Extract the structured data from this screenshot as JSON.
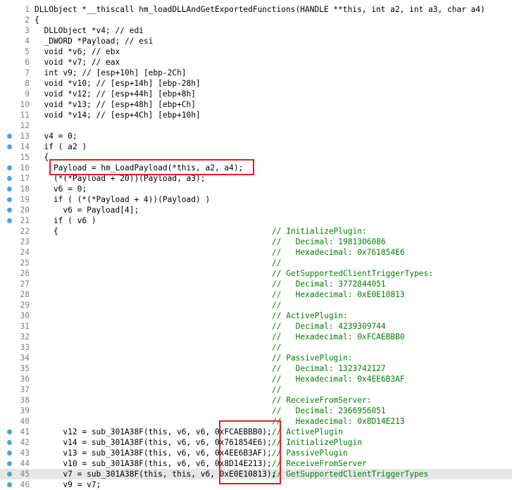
{
  "lines": [
    {
      "n": "1",
      "dot": false,
      "code": "DLLObject *__thiscall hm_loadDLLAndGetExportedFunctions(HANDLE **this, int a2, int a3, char a4)",
      "comment": ""
    },
    {
      "n": "2",
      "dot": false,
      "code": "{",
      "comment": ""
    },
    {
      "n": "3",
      "dot": false,
      "code": "  DLLObject *v4; // edi",
      "comment": ""
    },
    {
      "n": "4",
      "dot": false,
      "code": "  _DWORD *Payload; // esi",
      "comment": ""
    },
    {
      "n": "5",
      "dot": false,
      "code": "  void *v6; // ebx",
      "comment": ""
    },
    {
      "n": "6",
      "dot": false,
      "code": "  void *v7; // eax",
      "comment": ""
    },
    {
      "n": "7",
      "dot": false,
      "code": "  int v9; // [esp+10h] [ebp-2Ch]",
      "comment": ""
    },
    {
      "n": "8",
      "dot": false,
      "code": "  void *v10; // [esp+14h] [ebp-28h]",
      "comment": ""
    },
    {
      "n": "9",
      "dot": false,
      "code": "  void *v12; // [esp+44h] [ebp+8h]",
      "comment": ""
    },
    {
      "n": "10",
      "dot": false,
      "code": "  void *v13; // [esp+48h] [ebp+Ch]",
      "comment": ""
    },
    {
      "n": "11",
      "dot": false,
      "code": "  void *v14; // [esp+4Ch] [ebp+10h]",
      "comment": ""
    },
    {
      "n": "12",
      "dot": false,
      "code": "",
      "comment": ""
    },
    {
      "n": "13",
      "dot": true,
      "code": "  v4 = 0;",
      "comment": ""
    },
    {
      "n": "14",
      "dot": true,
      "code": "  if ( a2 )",
      "comment": ""
    },
    {
      "n": "15",
      "dot": false,
      "code": "  {",
      "comment": ""
    },
    {
      "n": "16",
      "dot": true,
      "code": "    Payload = hm_LoadPayload(*this, a2, a4);",
      "comment": ""
    },
    {
      "n": "17",
      "dot": true,
      "code": "    (*(*Payload + 20))(Payload, a3);",
      "comment": ""
    },
    {
      "n": "18",
      "dot": true,
      "code": "    v6 = 0;",
      "comment": ""
    },
    {
      "n": "19",
      "dot": true,
      "code": "    if ( (*(*Payload + 4))(Payload) )",
      "comment": ""
    },
    {
      "n": "20",
      "dot": true,
      "code": "      v6 = Payload[4];",
      "comment": ""
    },
    {
      "n": "21",
      "dot": true,
      "code": "    if ( v6 )",
      "comment": ""
    },
    {
      "n": "22",
      "dot": false,
      "code": "    {",
      "comment": "// InitializePlugin:"
    },
    {
      "n": "23",
      "dot": false,
      "code": "",
      "comment": "//   Decimal: 1981306086"
    },
    {
      "n": "24",
      "dot": false,
      "code": "",
      "comment": "//   Hexadecimal: 0x761854E6"
    },
    {
      "n": "25",
      "dot": false,
      "code": "",
      "comment": "//"
    },
    {
      "n": "26",
      "dot": false,
      "code": "",
      "comment": "// GetSupportedClientTriggerTypes:"
    },
    {
      "n": "27",
      "dot": false,
      "code": "",
      "comment": "//   Decimal: 3772844051"
    },
    {
      "n": "28",
      "dot": false,
      "code": "",
      "comment": "//   Hexadecimal: 0xE0E10813"
    },
    {
      "n": "29",
      "dot": false,
      "code": "",
      "comment": "//"
    },
    {
      "n": "30",
      "dot": false,
      "code": "",
      "comment": "// ActivePlugin:"
    },
    {
      "n": "31",
      "dot": false,
      "code": "",
      "comment": "//   Decimal: 4239309744"
    },
    {
      "n": "32",
      "dot": false,
      "code": "",
      "comment": "//   Hexadecimal: 0xFCAEBBB0"
    },
    {
      "n": "33",
      "dot": false,
      "code": "",
      "comment": "//"
    },
    {
      "n": "34",
      "dot": false,
      "code": "",
      "comment": "// PassivePlugin:"
    },
    {
      "n": "35",
      "dot": false,
      "code": "",
      "comment": "//   Decimal: 1323742127"
    },
    {
      "n": "36",
      "dot": false,
      "code": "",
      "comment": "//   Hexadecimal: 0x4EE6B3AF"
    },
    {
      "n": "37",
      "dot": false,
      "code": "",
      "comment": "//"
    },
    {
      "n": "38",
      "dot": false,
      "code": "",
      "comment": "// ReceiveFromServer:"
    },
    {
      "n": "39",
      "dot": false,
      "code": "",
      "comment": "//   Decimal: 2366956051"
    },
    {
      "n": "40",
      "dot": false,
      "code": "",
      "comment": "//   Hexadecimal: 0x8D14E213"
    },
    {
      "n": "41",
      "dot": true,
      "code": "      v12 = sub_301A38F(this, v6, v6, 0xFCAEBBB0);",
      "comment": "// ActivePlugin"
    },
    {
      "n": "42",
      "dot": true,
      "code": "      v14 = sub_301A38F(this, v6, v6, 0x761854E6);",
      "comment": "// InitializePlugin"
    },
    {
      "n": "43",
      "dot": true,
      "code": "      v13 = sub_301A38F(this, v6, v6, 0x4EE6B3AF);",
      "comment": "// PassivePlugin"
    },
    {
      "n": "44",
      "dot": true,
      "code": "      v10 = sub_301A38F(this, v6, v6, 0x8D14E213);",
      "comment": "// ReceiveFromServer"
    },
    {
      "n": "45",
      "dot": true,
      "code": "      v7 = sub_301A38F(this, this, v6, 0xE0E10813);",
      "comment": "// GetSupportedClientTriggerTypes"
    },
    {
      "n": "46",
      "dot": true,
      "code": "      v9 = v7;",
      "comment": ""
    }
  ],
  "highlighted_line": "45",
  "colors": {
    "line_dot": "#4fa3d6",
    "annotation_box": "#e0201e",
    "comment": "#008000",
    "line_number": "#808080"
  }
}
